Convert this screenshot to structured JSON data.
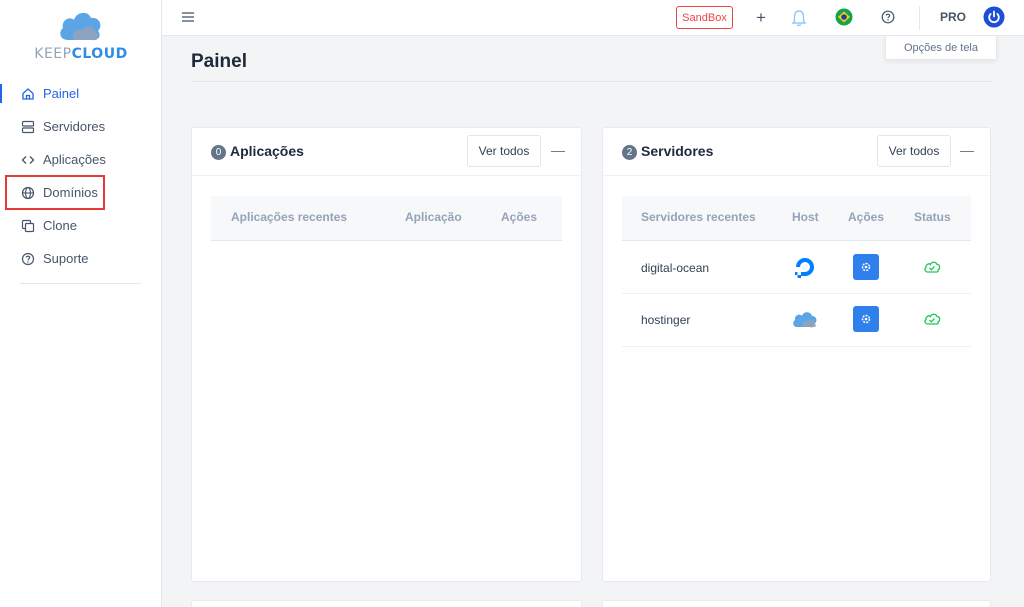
{
  "sidebar": {
    "logo": {
      "keep": "KEEP",
      "cloud": "CLOUD"
    },
    "items": [
      {
        "label": "Painel",
        "icon": "home-icon",
        "active": true
      },
      {
        "label": "Servidores",
        "icon": "server-icon"
      },
      {
        "label": "Aplicações",
        "icon": "code-icon"
      },
      {
        "label": "Domínios",
        "icon": "globe-icon",
        "highlighted": true
      },
      {
        "label": "Clone",
        "icon": "copy-icon"
      },
      {
        "label": "Suporte",
        "icon": "help-circle-icon"
      }
    ]
  },
  "topbar": {
    "sandbox_label": "SandBox",
    "pro_label": "PRO",
    "screen_options": "Opções de tela"
  },
  "main": {
    "title": "Painel",
    "apps_card": {
      "count": "0",
      "title": "Aplicações",
      "view_all": "Ver todos",
      "columns": [
        "Aplicações recentes",
        "Aplicação",
        "Ações"
      ]
    },
    "servers_card": {
      "count": "2",
      "title": "Servidores",
      "view_all": "Ver todos",
      "columns": [
        "Servidores recentes",
        "Host",
        "Ações",
        "Status"
      ],
      "rows": [
        {
          "name": "digital-ocean",
          "host_icon": "digitalocean-icon",
          "status": "online"
        },
        {
          "name": "hostinger",
          "host_icon": "cloud-host-icon",
          "status": "online"
        }
      ]
    }
  },
  "colors": {
    "accent": "#2563eb",
    "brand": "#2f8de4",
    "danger": "#ef4444",
    "success": "#22c55e"
  }
}
